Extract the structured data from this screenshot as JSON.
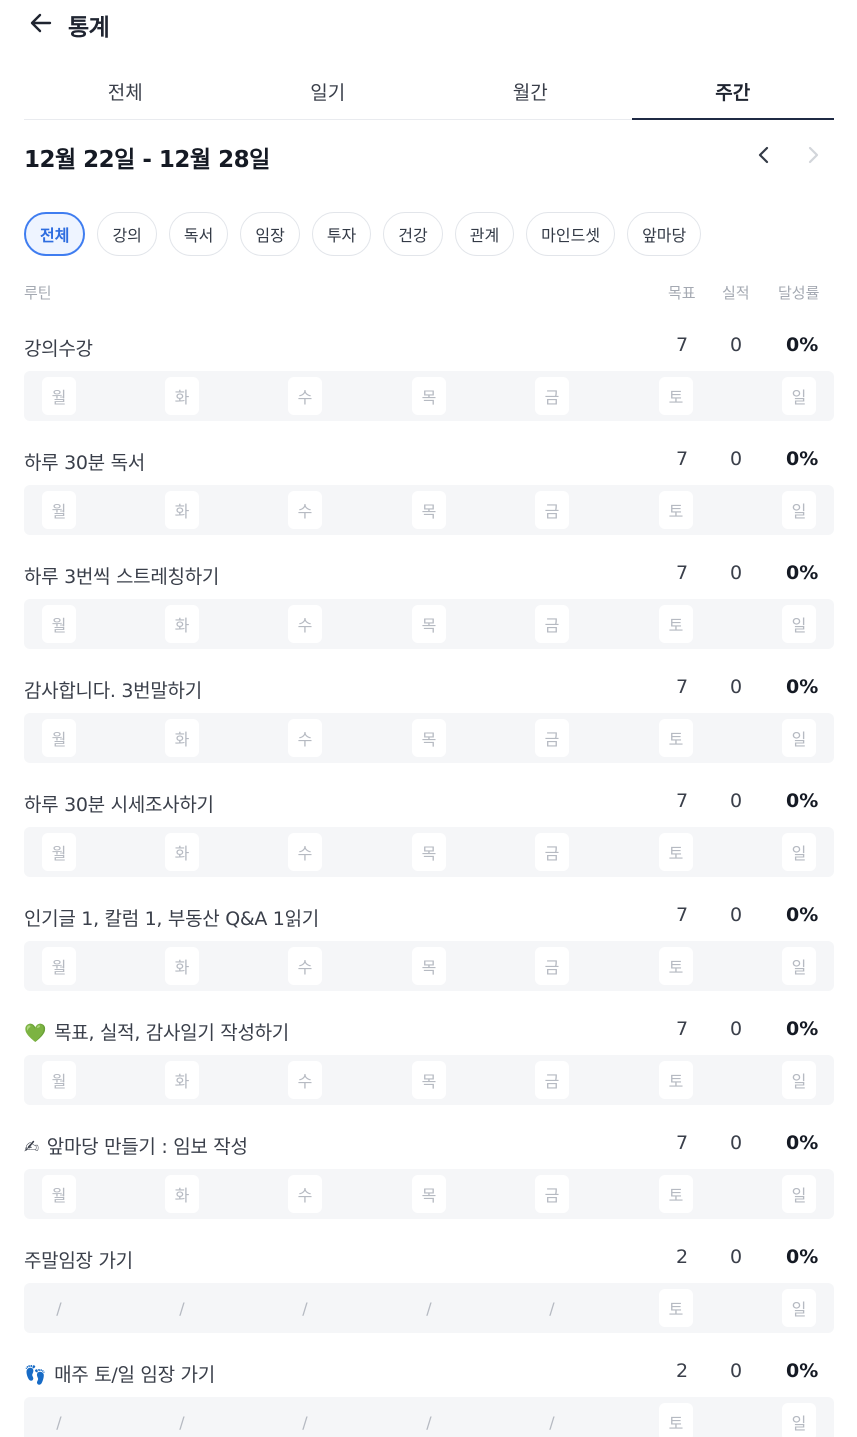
{
  "header": {
    "title": "통계"
  },
  "tabs": [
    {
      "label": "전체",
      "active": false
    },
    {
      "label": "일기",
      "active": false
    },
    {
      "label": "월간",
      "active": false
    },
    {
      "label": "주간",
      "active": true
    }
  ],
  "range": {
    "text": "12월 22일 - 12월 28일"
  },
  "chips": [
    {
      "label": "전체",
      "active": true
    },
    {
      "label": "강의",
      "active": false
    },
    {
      "label": "독서",
      "active": false
    },
    {
      "label": "임장",
      "active": false
    },
    {
      "label": "투자",
      "active": false
    },
    {
      "label": "건강",
      "active": false
    },
    {
      "label": "관계",
      "active": false
    },
    {
      "label": "마인드셋",
      "active": false
    },
    {
      "label": "앞마당",
      "active": false
    }
  ],
  "columns": {
    "routine": "루틴",
    "goal": "목표",
    "actual": "실적",
    "rate": "달성률"
  },
  "routines": [
    {
      "emoji": "",
      "title": "강의수강",
      "goal": "7",
      "actual": "0",
      "rate": "0%",
      "days": [
        "월",
        "화",
        "수",
        "목",
        "금",
        "토",
        "일"
      ]
    },
    {
      "emoji": "",
      "title": "하루 30분 독서",
      "goal": "7",
      "actual": "0",
      "rate": "0%",
      "days": [
        "월",
        "화",
        "수",
        "목",
        "금",
        "토",
        "일"
      ]
    },
    {
      "emoji": "",
      "title": "하루 3번씩 스트레칭하기",
      "goal": "7",
      "actual": "0",
      "rate": "0%",
      "days": [
        "월",
        "화",
        "수",
        "목",
        "금",
        "토",
        "일"
      ]
    },
    {
      "emoji": "",
      "title": "감사합니다. 3번말하기",
      "goal": "7",
      "actual": "0",
      "rate": "0%",
      "days": [
        "월",
        "화",
        "수",
        "목",
        "금",
        "토",
        "일"
      ]
    },
    {
      "emoji": "",
      "title": "하루 30분 시세조사하기",
      "goal": "7",
      "actual": "0",
      "rate": "0%",
      "days": [
        "월",
        "화",
        "수",
        "목",
        "금",
        "토",
        "일"
      ]
    },
    {
      "emoji": "",
      "title": "인기글 1, 칼럼 1, 부동산 Q&A 1읽기",
      "goal": "7",
      "actual": "0",
      "rate": "0%",
      "days": [
        "월",
        "화",
        "수",
        "목",
        "금",
        "토",
        "일"
      ]
    },
    {
      "emoji": "💚",
      "title": "목표, 실적, 감사일기 작성하기",
      "goal": "7",
      "actual": "0",
      "rate": "0%",
      "days": [
        "월",
        "화",
        "수",
        "목",
        "금",
        "토",
        "일"
      ]
    },
    {
      "emoji": "✍",
      "title": "앞마당 만들기 : 임보 작성",
      "goal": "7",
      "actual": "0",
      "rate": "0%",
      "days": [
        "월",
        "화",
        "수",
        "목",
        "금",
        "토",
        "일"
      ]
    },
    {
      "emoji": "",
      "title": "주말임장 가기",
      "goal": "2",
      "actual": "0",
      "rate": "0%",
      "days": [
        "/",
        "/",
        "/",
        "/",
        "/",
        "토",
        "일"
      ]
    },
    {
      "emoji": "👣",
      "title": "매주 토/일 임장 가기",
      "goal": "2",
      "actual": "0",
      "rate": "0%",
      "days": [
        "/",
        "/",
        "/",
        "/",
        "/",
        "토",
        "일"
      ]
    }
  ]
}
